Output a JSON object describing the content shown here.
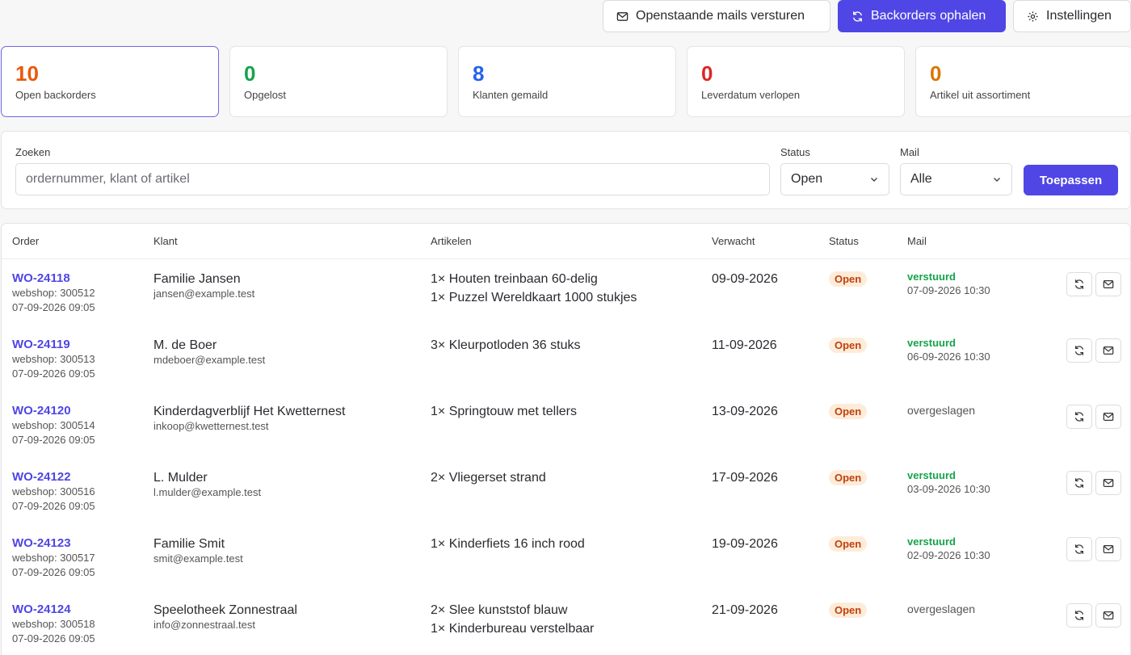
{
  "toolbar": {
    "send_mails": "Openstaande mails versturen",
    "fetch_backorders": "Backorders ophalen",
    "settings": "Instellingen"
  },
  "stats": [
    {
      "value": "10",
      "label": "Open backorders",
      "color": "#ea580c"
    },
    {
      "value": "0",
      "label": "Opgelost",
      "color": "#16a34a"
    },
    {
      "value": "8",
      "label": "Klanten gemaild",
      "color": "#2563eb"
    },
    {
      "value": "0",
      "label": "Leverdatum verlopen",
      "color": "#dc2626"
    },
    {
      "value": "0",
      "label": "Artikel uit assortiment",
      "color": "#d97706"
    }
  ],
  "filters": {
    "search_label": "Zoeken",
    "search_placeholder": "ordernummer, klant of artikel",
    "status_label": "Status",
    "status_value": "Open",
    "mail_label": "Mail",
    "mail_value": "Alle",
    "apply": "Toepassen"
  },
  "table": {
    "headers": {
      "order": "Order",
      "customer": "Klant",
      "items": "Artikelen",
      "expected": "Verwacht",
      "status": "Status",
      "mail": "Mail"
    },
    "rows": [
      {
        "order": "WO-24118",
        "webshop": "webshop: 300512",
        "created": "07-09-2026 09:05",
        "customer": "Familie Jansen",
        "email": "jansen@example.test",
        "items": [
          "1× Houten treinbaan 60-delig",
          "1× Puzzel Wereldkaart 1000 stukjes"
        ],
        "expected": "09-09-2026",
        "status": "Open",
        "mail_status": "verstuurd",
        "mail_date": "07-09-2026 10:30"
      },
      {
        "order": "WO-24119",
        "webshop": "webshop: 300513",
        "created": "07-09-2026 09:05",
        "customer": "M. de Boer",
        "email": "mdeboer@example.test",
        "items": [
          "3× Kleurpotloden 36 stuks"
        ],
        "expected": "11-09-2026",
        "status": "Open",
        "mail_status": "verstuurd",
        "mail_date": "06-09-2026 10:30"
      },
      {
        "order": "WO-24120",
        "webshop": "webshop: 300514",
        "created": "07-09-2026 09:05",
        "customer": "Kinderdagverblijf Het Kwetternest",
        "email": "inkoop@kwetternest.test",
        "items": [
          "1× Springtouw met tellers"
        ],
        "expected": "13-09-2026",
        "status": "Open",
        "mail_status": "overgeslagen",
        "mail_date": ""
      },
      {
        "order": "WO-24122",
        "webshop": "webshop: 300516",
        "created": "07-09-2026 09:05",
        "customer": "L. Mulder",
        "email": "l.mulder@example.test",
        "items": [
          "2× Vliegerset strand"
        ],
        "expected": "17-09-2026",
        "status": "Open",
        "mail_status": "verstuurd",
        "mail_date": "03-09-2026 10:30"
      },
      {
        "order": "WO-24123",
        "webshop": "webshop: 300517",
        "created": "07-09-2026 09:05",
        "customer": "Familie Smit",
        "email": "smit@example.test",
        "items": [
          "1× Kinderfiets 16 inch rood"
        ],
        "expected": "19-09-2026",
        "status": "Open",
        "mail_status": "verstuurd",
        "mail_date": "02-09-2026 10:30"
      },
      {
        "order": "WO-24124",
        "webshop": "webshop: 300518",
        "created": "07-09-2026 09:05",
        "customer": "Speelotheek Zonnestraal",
        "email": "info@zonnestraal.test",
        "items": [
          "2× Slee kunststof blauw",
          "1× Kinderbureau verstelbaar"
        ],
        "expected": "21-09-2026",
        "status": "Open",
        "mail_status": "overgeslagen",
        "mail_date": ""
      }
    ]
  },
  "icons": {
    "send_mails": "mail-icon",
    "fetch_backorders": "refresh-icon",
    "settings": "gear-icon",
    "select": "chevron-down-icon",
    "row_refresh": "refresh-icon",
    "row_mail": "mail-icon"
  }
}
